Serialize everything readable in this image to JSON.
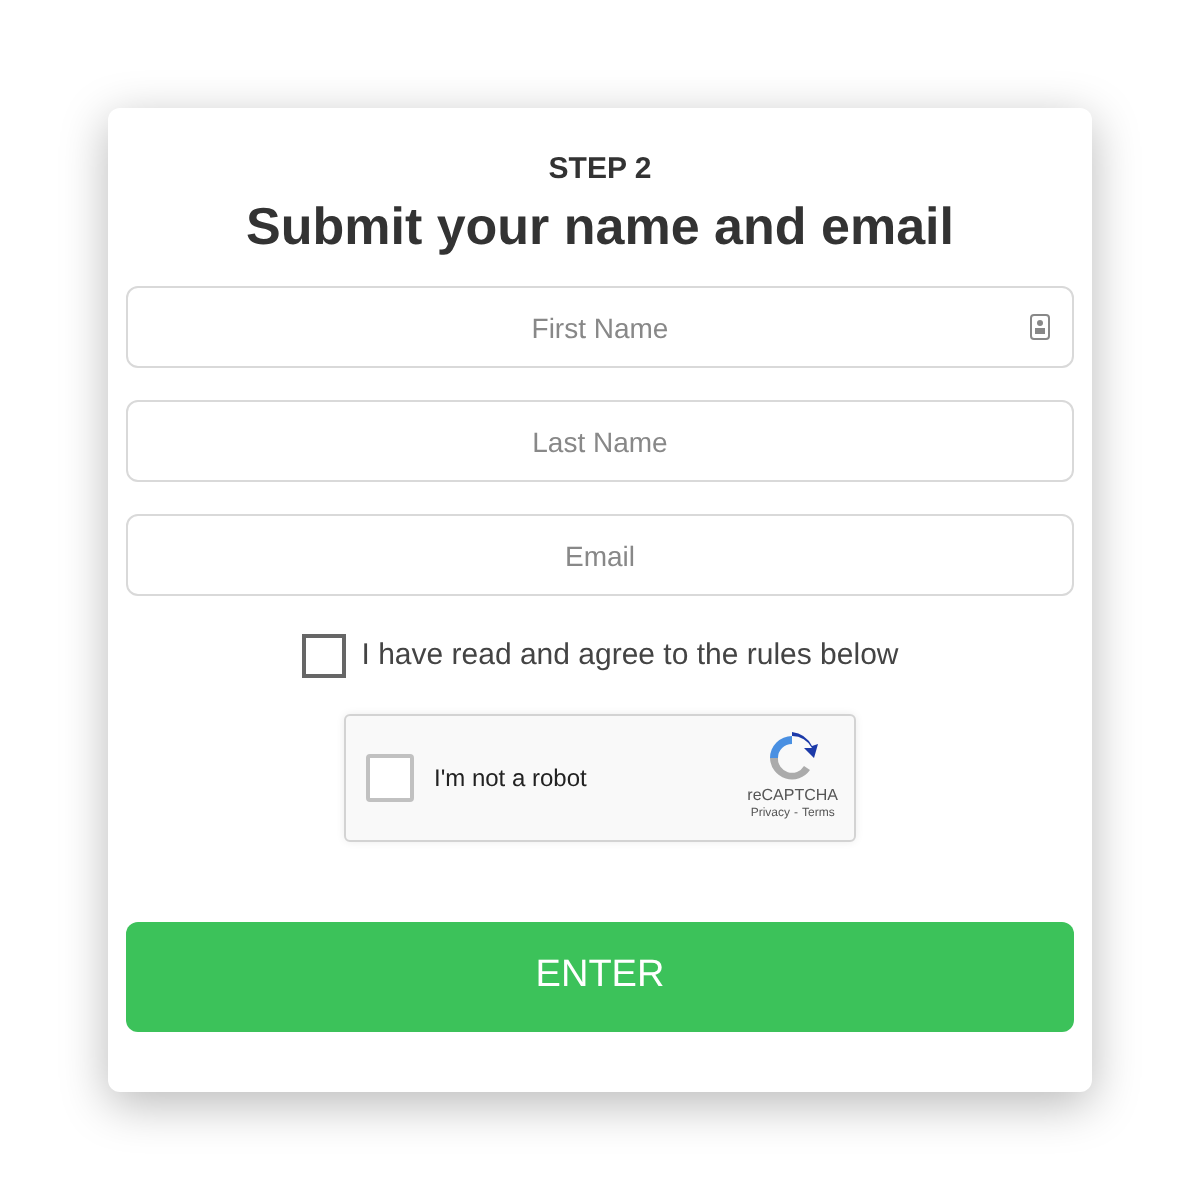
{
  "step": "STEP 2",
  "title": "Submit your name and email",
  "fields": [
    {
      "placeholder": "First Name",
      "kind": "contact"
    },
    {
      "placeholder": "Last Name",
      "kind": "plain"
    },
    {
      "placeholder": "Email",
      "kind": "plain"
    }
  ],
  "agree": {
    "label": "I have read and agree to the rules below",
    "checked": false
  },
  "captcha": {
    "label": "I'm not a robot",
    "checked": false,
    "brand": "reCAPTCHA",
    "privacy": "Privacy",
    "separator": "-",
    "terms": "Terms"
  },
  "button": "ENTER"
}
